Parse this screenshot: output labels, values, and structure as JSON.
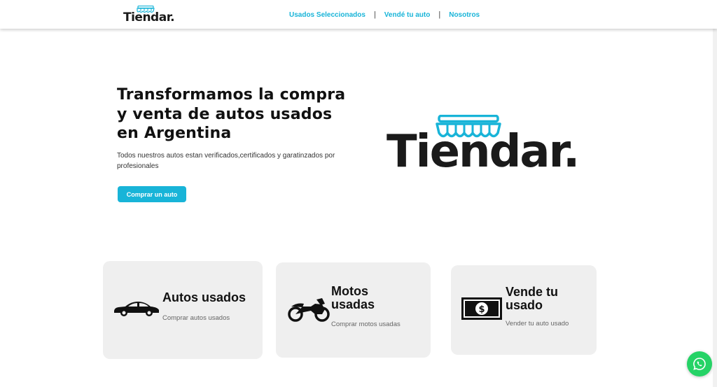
{
  "header": {
    "logo_text": "Tiendar.",
    "nav": [
      "Usados Seleccionados",
      "Vendé tu auto",
      "Nosotros"
    ]
  },
  "hero": {
    "title": "Transformamos la compra y venta de autos usados en Argentina",
    "subtitle": "Todos nuestros autos estan verificados,certificados y garatinzados por profesionales",
    "cta_label": "Comprar un auto",
    "logo_text": "Tiendar."
  },
  "cards": [
    {
      "title": "Autos usados",
      "subtitle": "Comprar autos usados",
      "icon": "car-icon"
    },
    {
      "title": "Motos usadas",
      "subtitle": "Comprar motos usadas",
      "icon": "motorcycle-icon"
    },
    {
      "title": "Vende tu usado",
      "subtitle": "Vender tu auto usado",
      "icon": "money-icon"
    }
  ],
  "colors": {
    "accent": "#18b4d8",
    "whatsapp": "#25d366",
    "card_bg": "#efefef"
  }
}
